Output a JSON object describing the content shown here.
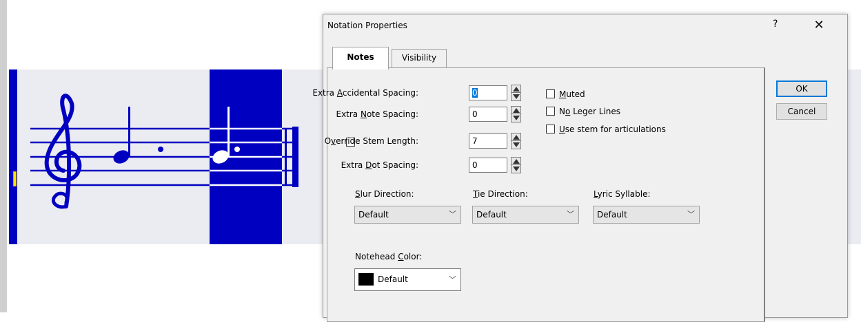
{
  "dialog": {
    "title": "Notation Properties",
    "help_glyph": "?",
    "close_glyph": "✕",
    "tabs": [
      {
        "label": "Notes",
        "active": true
      },
      {
        "label": "Visibility",
        "active": false
      }
    ],
    "fields": {
      "extra_accidental_spacing": {
        "label_pre": "Extra ",
        "label_u": "A",
        "label_post": "ccidental Spacing:",
        "value": "0"
      },
      "extra_note_spacing": {
        "label_pre": "Extra ",
        "label_u": "N",
        "label_post": "ote Spacing:",
        "value": "0"
      },
      "override_stem_length": {
        "label_pre": "O",
        "label_u": "v",
        "label_post": "erride Stem Length:",
        "value": "7",
        "checked": false
      },
      "extra_dot_spacing": {
        "label_pre": "Extra ",
        "label_u": "D",
        "label_post": "ot Spacing:",
        "value": "0"
      }
    },
    "checkboxes": {
      "muted": {
        "label_u": "M",
        "label_post": "uted",
        "checked": false
      },
      "no_leger_lines": {
        "label_pre": "N",
        "label_u": "o",
        "label_post": " Leger Lines",
        "checked": false
      },
      "use_stem": {
        "label_u": "U",
        "label_post": "se stem for articulations",
        "checked": false
      }
    },
    "dropdowns": {
      "slur_direction": {
        "label_u": "S",
        "label_post": "lur Direction:",
        "value": "Default"
      },
      "tie_direction": {
        "label_u": "T",
        "label_post": "ie Direction:",
        "value": "Default"
      },
      "lyric_syllable": {
        "label_u": "L",
        "label_post": "yric Syllable:",
        "value": "Default"
      },
      "notehead_color": {
        "label_pre": "Notehead ",
        "label_u": "C",
        "label_post": "olor:",
        "value": "Default",
        "swatch": "#000000"
      }
    },
    "buttons": {
      "ok": "OK",
      "cancel": "Cancel"
    },
    "caret_glyph": "﹀"
  },
  "colors": {
    "staff": "#0000c0",
    "selection": "#0000c0",
    "cursor": "#ffe600",
    "accent": "#0078d7"
  }
}
